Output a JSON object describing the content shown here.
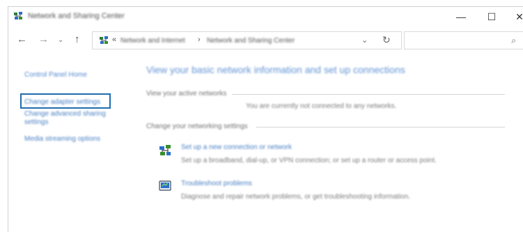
{
  "window": {
    "title": "Network and Sharing Center",
    "controls": {
      "minimize": "—",
      "maximize": "☐",
      "close": "✕"
    }
  },
  "nav": {
    "back": "←",
    "forward": "→",
    "recent": "⌄",
    "up": "↑",
    "address_prefix": "«",
    "breadcrumbs": [
      "Network and Internet",
      "Network and Sharing Center"
    ],
    "crumb_separator": "›",
    "dropdown": "⌄",
    "refresh": "↻",
    "search_placeholder": "",
    "search_icon": "⌕"
  },
  "sidebar": {
    "home": "Control Panel Home",
    "adapter": "Change adapter settings",
    "sharing": "Change advanced sharing settings",
    "media": "Media streaming options"
  },
  "main": {
    "heading": "View your basic network information and set up connections",
    "active_title": "View your active networks",
    "status": "You are currently not connected to any networks.",
    "change_title": "Change your networking settings",
    "tasks": [
      {
        "icon": "network-setup-icon",
        "link": "Set up a new connection or network",
        "desc": "Set up a broadband, dial-up, or VPN connection; or set up a router or access point."
      },
      {
        "icon": "troubleshoot-icon",
        "link": "Troubleshoot problems",
        "desc": "Diagnose and repair network problems, or get troubleshooting information."
      }
    ]
  },
  "colors": {
    "accent": "#1f6db0",
    "link": "#1a5fb4"
  }
}
